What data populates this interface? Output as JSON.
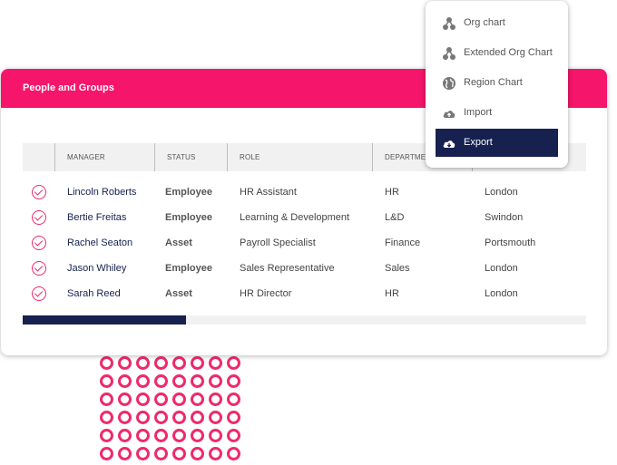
{
  "card": {
    "title": "People and Groups"
  },
  "table": {
    "columns": [
      "",
      "MANAGER",
      "STATUS",
      "ROLE",
      "DEPARTMENT",
      ""
    ],
    "rows": [
      {
        "manager": "Lincoln Roberts",
        "status": "Employee",
        "role": "HR Assistant",
        "department": "HR",
        "location": "London"
      },
      {
        "manager": "Bertie Freitas",
        "status": "Employee",
        "role": "Learning & Development",
        "department": "L&D",
        "location": "Swindon"
      },
      {
        "manager": "Rachel Seaton",
        "status": "Asset",
        "role": "Payroll Specialist",
        "department": "Finance",
        "location": "Portsmouth"
      },
      {
        "manager": "Jason Whiley",
        "status": "Employee",
        "role": "Sales Representative",
        "department": "Sales",
        "location": "London"
      },
      {
        "manager": "Sarah Reed",
        "status": "Asset",
        "role": "HR Director",
        "department": "HR",
        "location": "London"
      }
    ],
    "scroll_position": 0.29
  },
  "menu": {
    "items": [
      {
        "label": "Org chart",
        "icon": "org-chart-icon"
      },
      {
        "label": "Extended Org Chart",
        "icon": "extended-org-chart-icon"
      },
      {
        "label": "Region Chart",
        "icon": "globe-icon"
      },
      {
        "label": "Import",
        "icon": "cloud-upload-icon"
      },
      {
        "label": "Export",
        "icon": "cloud-download-icon"
      }
    ],
    "active_index": 4
  },
  "colors": {
    "brand_pink": "#f5156b",
    "navy": "#16214f",
    "check": "#ee2a6b"
  }
}
